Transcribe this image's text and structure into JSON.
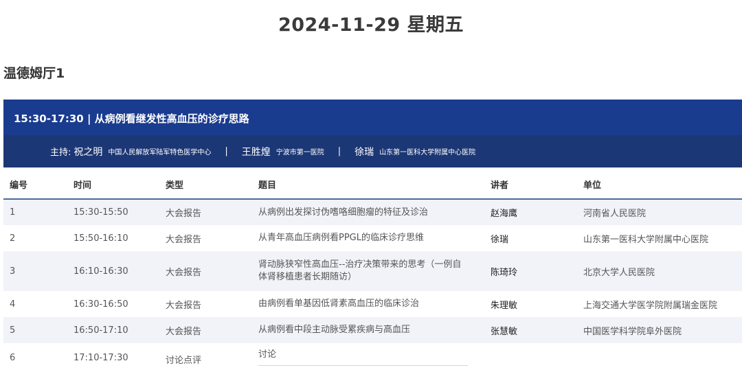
{
  "date_title": "2024-11-29 星期五",
  "hall": "温德姆厅1",
  "session": {
    "title": "15:30-17:30 | 从病例看继发性高血压的诊疗思路",
    "chair_label": "主持:",
    "chairs": [
      {
        "name": "祝之明",
        "org": "中国人民解放军陆军特色医学中心"
      },
      {
        "name": "王胜煌",
        "org": "宁波市第一医院"
      },
      {
        "name": "徐瑞",
        "org": "山东第一医科大学附属中心医院"
      }
    ],
    "separator": "|"
  },
  "table": {
    "headers": [
      "编号",
      "时间",
      "类型",
      "题目",
      "讲者",
      "单位"
    ],
    "rows": [
      {
        "no": "1",
        "time": "15:30-15:50",
        "type": "大会报告",
        "topic": "从病例出发探讨伪嗜咯细胞瘤的特征及诊治",
        "speaker": "赵海鹰",
        "unit": "河南省人民医院"
      },
      {
        "no": "2",
        "time": "15:50-16:10",
        "type": "大会报告",
        "topic": "从青年高血压病例看PPGL的临床诊疗思维",
        "speaker": "徐瑞",
        "unit": "山东第一医科大学附属中心医院"
      },
      {
        "no": "3",
        "time": "16:10-16:30",
        "type": "大会报告",
        "topic": "肾动脉狭窄性高血压--治疗决策带来的思考（一例自体肾移植患者长期随访）",
        "speaker": "陈琦玲",
        "unit": "北京大学人民医院"
      },
      {
        "no": "4",
        "time": "16:30-16:50",
        "type": "大会报告",
        "topic": "由病例看单基因低肾素高血压的临床诊治",
        "speaker": "朱理敏",
        "unit": "上海交通大学医学院附属瑞金医院"
      },
      {
        "no": "5",
        "time": "16:50-17:10",
        "type": "大会报告",
        "topic": "从病例看中段主动脉受累疾病与高血压",
        "speaker": "张慧敏",
        "unit": "中国医学科学院阜外医院"
      },
      {
        "no": "6",
        "time": "17:10-17:30",
        "type": "讨论点评",
        "topic": "讨论",
        "speaker": "",
        "unit": ""
      }
    ]
  }
}
